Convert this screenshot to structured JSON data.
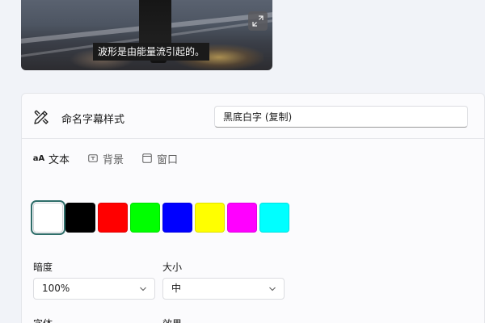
{
  "preview": {
    "caption": "波形是由能量流引起的。",
    "expand_icon": "expand-diagonal-icon"
  },
  "style_name": {
    "label": "命名字幕样式",
    "icon": "pen-ruler-icon",
    "value": "黑底白字 (复制)"
  },
  "tabs": [
    {
      "label": "文本",
      "icon": "text-aa-icon",
      "active": true
    },
    {
      "label": "背景",
      "icon": "background-icon",
      "active": false
    },
    {
      "label": "窗口",
      "icon": "window-icon",
      "active": false
    }
  ],
  "text_icon_glyph": "aA",
  "colors": [
    {
      "hex": "#ffffff",
      "selected": true
    },
    {
      "hex": "#000000",
      "selected": false
    },
    {
      "hex": "#ff0000",
      "selected": false
    },
    {
      "hex": "#00ff00",
      "selected": false
    },
    {
      "hex": "#0000ff",
      "selected": false
    },
    {
      "hex": "#ffff00",
      "selected": false
    },
    {
      "hex": "#ff00ff",
      "selected": false
    },
    {
      "hex": "#00ffff",
      "selected": false
    }
  ],
  "opacity": {
    "label": "暗度",
    "value": "100%"
  },
  "size": {
    "label": "大小",
    "value": "中"
  },
  "font": {
    "label": "字体"
  },
  "effect": {
    "label": "效果"
  },
  "accent_color": "#2f6e6a"
}
